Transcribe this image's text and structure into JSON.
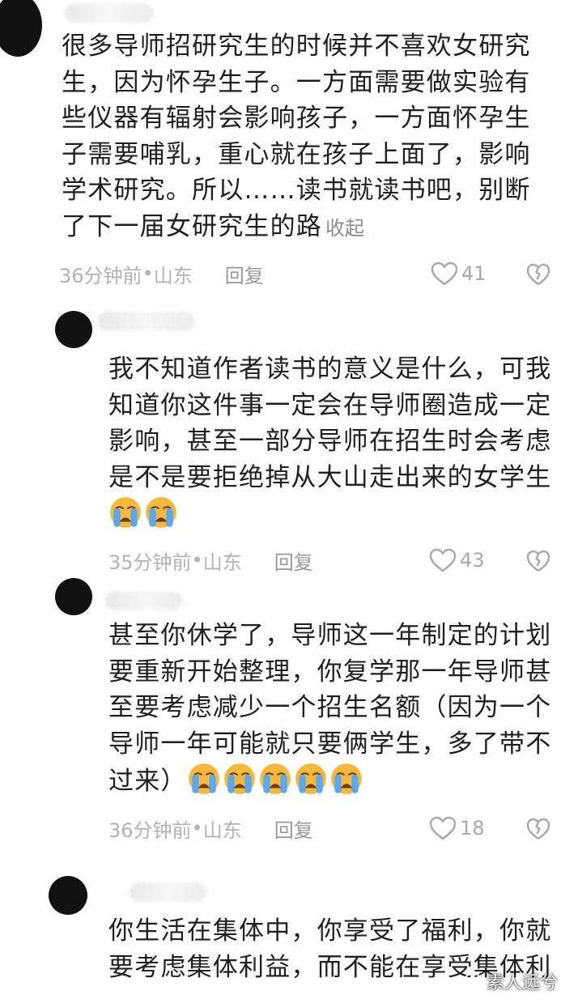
{
  "comments": [
    {
      "lines": [
        "很多导师招研究生的时候并不喜欢女研究",
        "生，因为怀孕生子。一方面需要做实验有",
        "些仪器有辐射会影响孩子，一方面怀孕生",
        "子需要哺乳，重心就在孩子上面了，影响",
        "学术研究。所以……读书就读书吧，别断",
        "了下一届女研究生的路"
      ],
      "collapse_label": "收起",
      "time": "36分钟前",
      "location": "山东",
      "reply_label": "回复",
      "likes": "41"
    },
    {
      "lines": [
        "我不知道作者读书的意义是什么，可我",
        "知道你这件事一定会在导师圈造成一定",
        "影响，甚至一部分导师在招生时会考虑",
        "是不是要拒绝掉从大山走出来的女学生"
      ],
      "emoji": "loudly-crying-face",
      "emoji_count": 2,
      "time": "35分钟前",
      "location": "山东",
      "reply_label": "回复",
      "likes": "43"
    },
    {
      "lines": [
        "甚至你休学了，导师这一年制定的计划",
        "要重新开始整理，你复学那一年导师甚",
        "至要考虑减少一个招生名额（因为一个",
        "导师一年可能就只要俩学生，多了带不",
        "过来）"
      ],
      "emoji": "loudly-crying-face",
      "emoji_count": 5,
      "time": "36分钟前",
      "location": "山东",
      "reply_label": "回复",
      "likes": "18"
    },
    {
      "lines": [
        "你生活在集体中，你享受了福利，你就",
        "要考虑集体利益，而不能在享受集体利"
      ]
    }
  ],
  "meta_separator": " • ",
  "watermark": "素人远兮",
  "colors": {
    "text": "#1f1f1f",
    "meta": "#b3b3b3",
    "emoji_face": "#f5b93a",
    "emoji_tears": "#5aa8f0"
  }
}
